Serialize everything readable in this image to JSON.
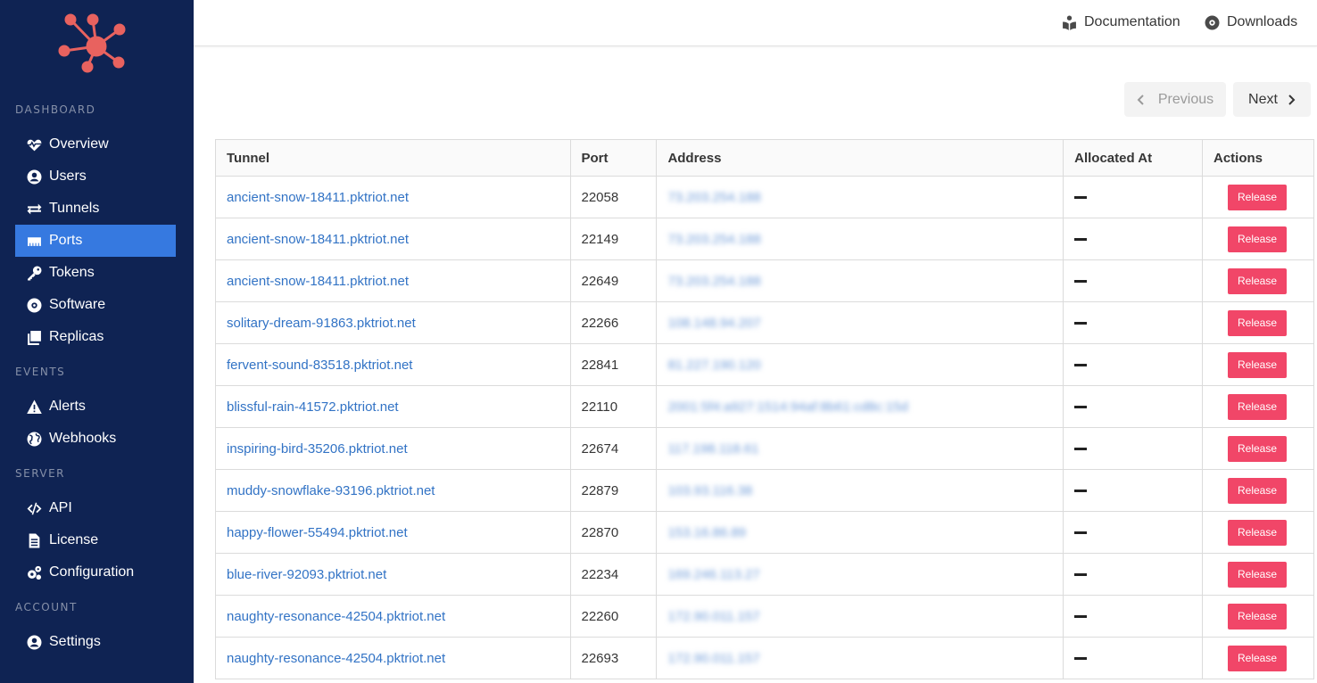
{
  "sidebar": {
    "sections": [
      "DASHBOARD",
      "EVENTS",
      "SERVER",
      "ACCOUNT"
    ],
    "items": [
      {
        "label": "Overview",
        "icon": "heartbeat-icon"
      },
      {
        "label": "Users",
        "icon": "user-circle-icon"
      },
      {
        "label": "Tunnels",
        "icon": "exchange-icon"
      },
      {
        "label": "Ports",
        "icon": "ethernet-icon",
        "active": true
      },
      {
        "label": "Tokens",
        "icon": "key-icon"
      },
      {
        "label": "Software",
        "icon": "disc-icon"
      },
      {
        "label": "Replicas",
        "icon": "copy-icon"
      },
      {
        "label": "Alerts",
        "icon": "warning-icon"
      },
      {
        "label": "Webhooks",
        "icon": "globe-icon"
      },
      {
        "label": "API",
        "icon": "code-icon"
      },
      {
        "label": "License",
        "icon": "file-icon"
      },
      {
        "label": "Configuration",
        "icon": "cogs-icon"
      },
      {
        "label": "Settings",
        "icon": "user-circle-icon"
      }
    ]
  },
  "topbar": {
    "documentation": "Documentation",
    "downloads": "Downloads"
  },
  "pagination": {
    "previous": "Previous",
    "next": "Next"
  },
  "table": {
    "headers": [
      "Tunnel",
      "Port",
      "Address",
      "Allocated At",
      "Actions"
    ],
    "action_label": "Release",
    "rows": [
      {
        "tunnel": "ancient-snow-18411.pktriot.net",
        "port": "22058",
        "address": "73.203.254.188"
      },
      {
        "tunnel": "ancient-snow-18411.pktriot.net",
        "port": "22149",
        "address": "73.203.254.188"
      },
      {
        "tunnel": "ancient-snow-18411.pktriot.net",
        "port": "22649",
        "address": "73.203.254.188"
      },
      {
        "tunnel": "solitary-dream-91863.pktriot.net",
        "port": "22266",
        "address": "108.148.94.207"
      },
      {
        "tunnel": "fervent-sound-83518.pktriot.net",
        "port": "22841",
        "address": "81.227.190.120"
      },
      {
        "tunnel": "blissful-rain-41572.pktriot.net",
        "port": "22110",
        "address": "2001:5f4:a927:1514:94af:8b61:cd8c:15d"
      },
      {
        "tunnel": "inspiring-bird-35206.pktriot.net",
        "port": "22674",
        "address": "117.198.118.61"
      },
      {
        "tunnel": "muddy-snowflake-93196.pktriot.net",
        "port": "22879",
        "address": "103.93.116.38"
      },
      {
        "tunnel": "happy-flower-55494.pktriot.net",
        "port": "22870",
        "address": "153.16.86.89"
      },
      {
        "tunnel": "blue-river-92093.pktriot.net",
        "port": "22234",
        "address": "169.246.113.27"
      },
      {
        "tunnel": "naughty-resonance-42504.pktriot.net",
        "port": "22260",
        "address": "172.90.011.157"
      },
      {
        "tunnel": "naughty-resonance-42504.pktriot.net",
        "port": "22693",
        "address": "172.90.011.157"
      }
    ]
  },
  "colors": {
    "sidebar_bg": "#0f2353",
    "active_item": "#3679e0",
    "logo": "#e8625f",
    "link": "#3273c5",
    "release_button": "#f14668"
  }
}
